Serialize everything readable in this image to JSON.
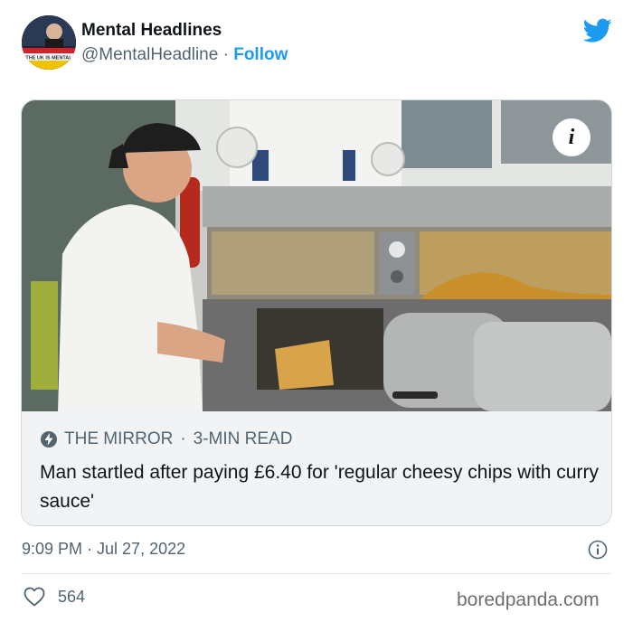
{
  "tweet": {
    "author_name": "Mental Headlines",
    "handle": "@MentalHeadline",
    "separator": "·",
    "follow_label": "Follow",
    "avatar_text": "THE UK IS MENTAL",
    "timestamp": "9:09 PM · Jul 27, 2022",
    "likes": "564"
  },
  "card": {
    "source": "THE MIRROR",
    "separator": "·",
    "read_time": "3-MIN READ",
    "headline": "Man startled after paying £6.40 for 'regular cheesy chips with curry sauce'"
  },
  "watermark": "boredpanda.com",
  "colors": {
    "brand_blue": "#1d9bf0",
    "secondary_text": "#536471",
    "card_meta_bg": "#f1f3f5"
  }
}
